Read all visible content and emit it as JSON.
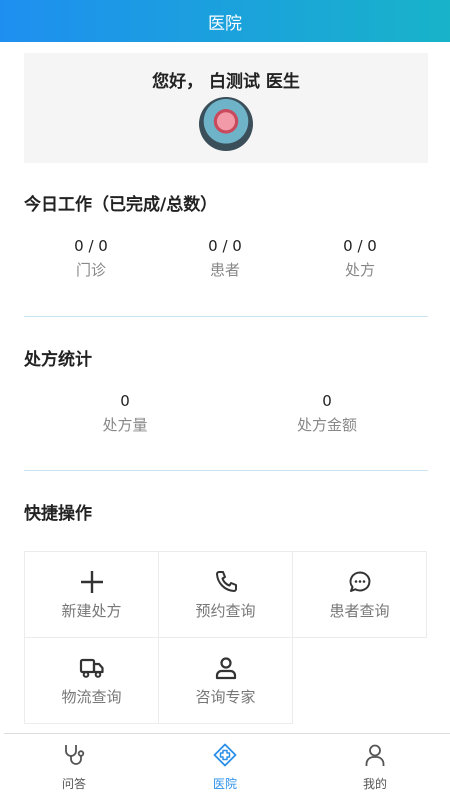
{
  "header": {
    "title": "医院"
  },
  "greeting": {
    "text": "您好，  白测试 医生"
  },
  "today_work": {
    "title": "今日工作（已完成/总数）",
    "stats": [
      {
        "value": "0 / 0",
        "label": "门诊"
      },
      {
        "value": "0 / 0",
        "label": "患者"
      },
      {
        "value": "0 / 0",
        "label": "处方"
      }
    ]
  },
  "prescription_stats": {
    "title": "处方统计",
    "stats": [
      {
        "value": "0",
        "label": "处方量"
      },
      {
        "value": "0",
        "label": "处方金额"
      }
    ]
  },
  "quick_actions": {
    "title": "快捷操作",
    "items": [
      {
        "label": "新建处方",
        "icon": "plus-icon"
      },
      {
        "label": "预约查询",
        "icon": "phone-icon"
      },
      {
        "label": "患者查询",
        "icon": "chat-icon"
      },
      {
        "label": "物流查询",
        "icon": "truck-icon"
      },
      {
        "label": "咨询专家",
        "icon": "user-icon"
      }
    ]
  },
  "tabbar": {
    "items": [
      {
        "label": "问答",
        "icon": "stethoscope-icon",
        "active": false
      },
      {
        "label": "医院",
        "icon": "hospital-icon",
        "active": true
      },
      {
        "label": "我的",
        "icon": "person-icon",
        "active": false
      }
    ]
  },
  "colors": {
    "accent": "#2a8fe8",
    "header_start": "#1e8ff0",
    "header_end": "#18b3c9"
  }
}
